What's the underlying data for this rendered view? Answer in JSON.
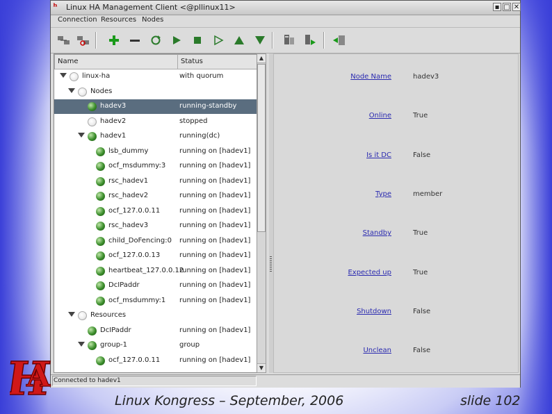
{
  "window": {
    "title": "Linux HA Management Client <@pllinux11>",
    "buttons": [
      "▪",
      "□",
      "✕"
    ]
  },
  "menubar": {
    "items": [
      "Connection",
      "Resources",
      "Nodes"
    ]
  },
  "toolbar": {
    "icons": [
      "connect-icon",
      "disconnect-icon",
      "add-icon",
      "remove-icon",
      "cleanup-icon",
      "start-icon",
      "stop-icon",
      "default-icon",
      "move-up-icon",
      "move-down-icon",
      "standby-icon",
      "active-icon",
      "exit-icon"
    ]
  },
  "tree": {
    "headers": {
      "name": "Name",
      "status": "Status"
    },
    "rows": [
      {
        "name": "linux-ha",
        "status": "with quorum",
        "level": 0,
        "icon": "bulb",
        "expander": true
      },
      {
        "name": "Nodes",
        "status": "",
        "level": 1,
        "icon": "bulb",
        "expander": true
      },
      {
        "name": "hadev3",
        "status": "running-standby",
        "level": 2,
        "icon": "green",
        "expander": false,
        "selected": true
      },
      {
        "name": "hadev2",
        "status": "stopped",
        "level": 2,
        "icon": "bulb",
        "expander": false
      },
      {
        "name": "hadev1",
        "status": "running(dc)",
        "level": 2,
        "icon": "green",
        "expander": true
      },
      {
        "name": "lsb_dummy",
        "status": "running on [hadev1]",
        "level": 3,
        "icon": "green",
        "expander": false
      },
      {
        "name": "ocf_msdummy:3",
        "status": "running on [hadev1]",
        "level": 3,
        "icon": "green",
        "expander": false
      },
      {
        "name": "rsc_hadev1",
        "status": "running on [hadev1]",
        "level": 3,
        "icon": "green",
        "expander": false
      },
      {
        "name": "rsc_hadev2",
        "status": "running on [hadev1]",
        "level": 3,
        "icon": "green",
        "expander": false
      },
      {
        "name": "ocf_127.0.0.11",
        "status": "running on [hadev1]",
        "level": 3,
        "icon": "green",
        "expander": false
      },
      {
        "name": "rsc_hadev3",
        "status": "running on [hadev1]",
        "level": 3,
        "icon": "green",
        "expander": false
      },
      {
        "name": "child_DoFencing:0",
        "status": "running on [hadev1]",
        "level": 3,
        "icon": "green",
        "expander": false
      },
      {
        "name": "ocf_127.0.0.13",
        "status": "running on [hadev1]",
        "level": 3,
        "icon": "green",
        "expander": false
      },
      {
        "name": "heartbeat_127.0.0.12",
        "status": "running on [hadev1]",
        "level": 3,
        "icon": "green",
        "expander": false
      },
      {
        "name": "DcIPaddr",
        "status": "running on [hadev1]",
        "level": 3,
        "icon": "green",
        "expander": false
      },
      {
        "name": "ocf_msdummy:1",
        "status": "running on [hadev1]",
        "level": 3,
        "icon": "green",
        "expander": false
      },
      {
        "name": "Resources",
        "status": "",
        "level": 1,
        "icon": "bulb",
        "expander": true
      },
      {
        "name": "DcIPaddr",
        "status": "running on [hadev1]",
        "level": 2,
        "icon": "green",
        "expander": false
      },
      {
        "name": "group-1",
        "status": "group",
        "level": 2,
        "icon": "green",
        "expander": true
      },
      {
        "name": "ocf_127.0.0.11",
        "status": "running on [hadev1]",
        "level": 3,
        "icon": "green",
        "expander": false
      }
    ]
  },
  "properties": [
    {
      "label": "Node Name",
      "value": "hadev3"
    },
    {
      "label": "Online",
      "value": "True"
    },
    {
      "label": "Is it DC",
      "value": "False"
    },
    {
      "label": "Type",
      "value": "member"
    },
    {
      "label": "Standby",
      "value": "True"
    },
    {
      "label": "Expected up",
      "value": "True"
    },
    {
      "label": "Shutdown",
      "value": "False"
    },
    {
      "label": "Unclean",
      "value": "False"
    }
  ],
  "statusbar": {
    "text": "Connected to hadev1"
  },
  "slide": {
    "footer_center": "Linux Kongress – September, 2006",
    "footer_right": "slide 102",
    "logo_text": "HA"
  }
}
